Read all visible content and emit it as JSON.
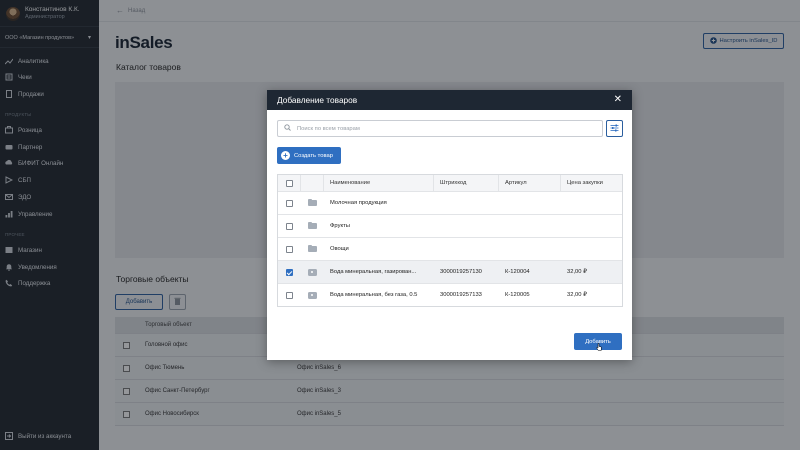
{
  "sidebar": {
    "user": {
      "name": "Константинов К.К.",
      "role": "Администратор"
    },
    "org": "ООО «Магазин продуктов»",
    "items_top": [
      {
        "label": "Аналитика",
        "icon": "analytics-icon"
      },
      {
        "label": "Чеки",
        "icon": "receipt-icon"
      },
      {
        "label": "Продажи",
        "icon": "sales-icon"
      }
    ],
    "section_products": "ПРОДУКТЫ",
    "items_products": [
      {
        "label": "Розница",
        "icon": "retail-icon"
      },
      {
        "label": "Партнер",
        "icon": "partner-icon"
      },
      {
        "label": "БИФИТ Онлайн",
        "icon": "online-icon"
      },
      {
        "label": "СБП",
        "icon": "sbp-icon"
      },
      {
        "label": "ЭДО",
        "icon": "edo-icon"
      },
      {
        "label": "Управление",
        "icon": "management-icon"
      }
    ],
    "section_other": "ПРОЧЕЕ",
    "items_other": [
      {
        "label": "Магазин",
        "icon": "store-icon"
      },
      {
        "label": "Уведомления",
        "icon": "bell-icon"
      },
      {
        "label": "Поддержка",
        "icon": "support-icon"
      }
    ],
    "logout": "Выйти из аккаунта"
  },
  "header": {
    "back": "Назад",
    "logo": "inSales",
    "setup_button": "Настроить inSales_ID"
  },
  "main": {
    "catalog_title": "Каталог товаров",
    "trade_title": "Торговые объекты",
    "add_button": "Добавить",
    "table_header": "Торговый объект",
    "rows": [
      {
        "name": "Головной офис",
        "value": ""
      },
      {
        "name": "Офис Тюмень",
        "value": "Офис inSales_6"
      },
      {
        "name": "Офис Санкт-Петербург",
        "value": "Офис inSales_3"
      },
      {
        "name": "Офис Новосибирск",
        "value": "Офис inSales_5"
      }
    ]
  },
  "modal": {
    "title": "Добавление товаров",
    "search_placeholder": "Поиск по всем товарам",
    "create_button": "Создать товар",
    "columns": [
      "Наименование",
      "Штрихкод",
      "Артикул",
      "Цена закупки"
    ],
    "rows": [
      {
        "type": "folder",
        "checked": false,
        "name": "Молочная продукция",
        "barcode": "",
        "article": "",
        "price": ""
      },
      {
        "type": "folder",
        "checked": false,
        "name": "Фрукты",
        "barcode": "",
        "article": "",
        "price": ""
      },
      {
        "type": "folder",
        "checked": false,
        "name": "Овощи",
        "barcode": "",
        "article": "",
        "price": ""
      },
      {
        "type": "product",
        "checked": true,
        "name": "Вода минеральная, газирован...",
        "barcode": "3000019257130",
        "article": "К-120004",
        "price": "32,00 ₽"
      },
      {
        "type": "product",
        "checked": false,
        "name": "Вода минеральная, без газа, 0.5",
        "barcode": "3000019257133",
        "article": "К-120005",
        "price": "32,00 ₽"
      }
    ],
    "add_button": "Добавить"
  },
  "colors": {
    "sidebar": "#1f252d",
    "accent": "#2f6fc1",
    "modal_header": "#1e2733"
  }
}
